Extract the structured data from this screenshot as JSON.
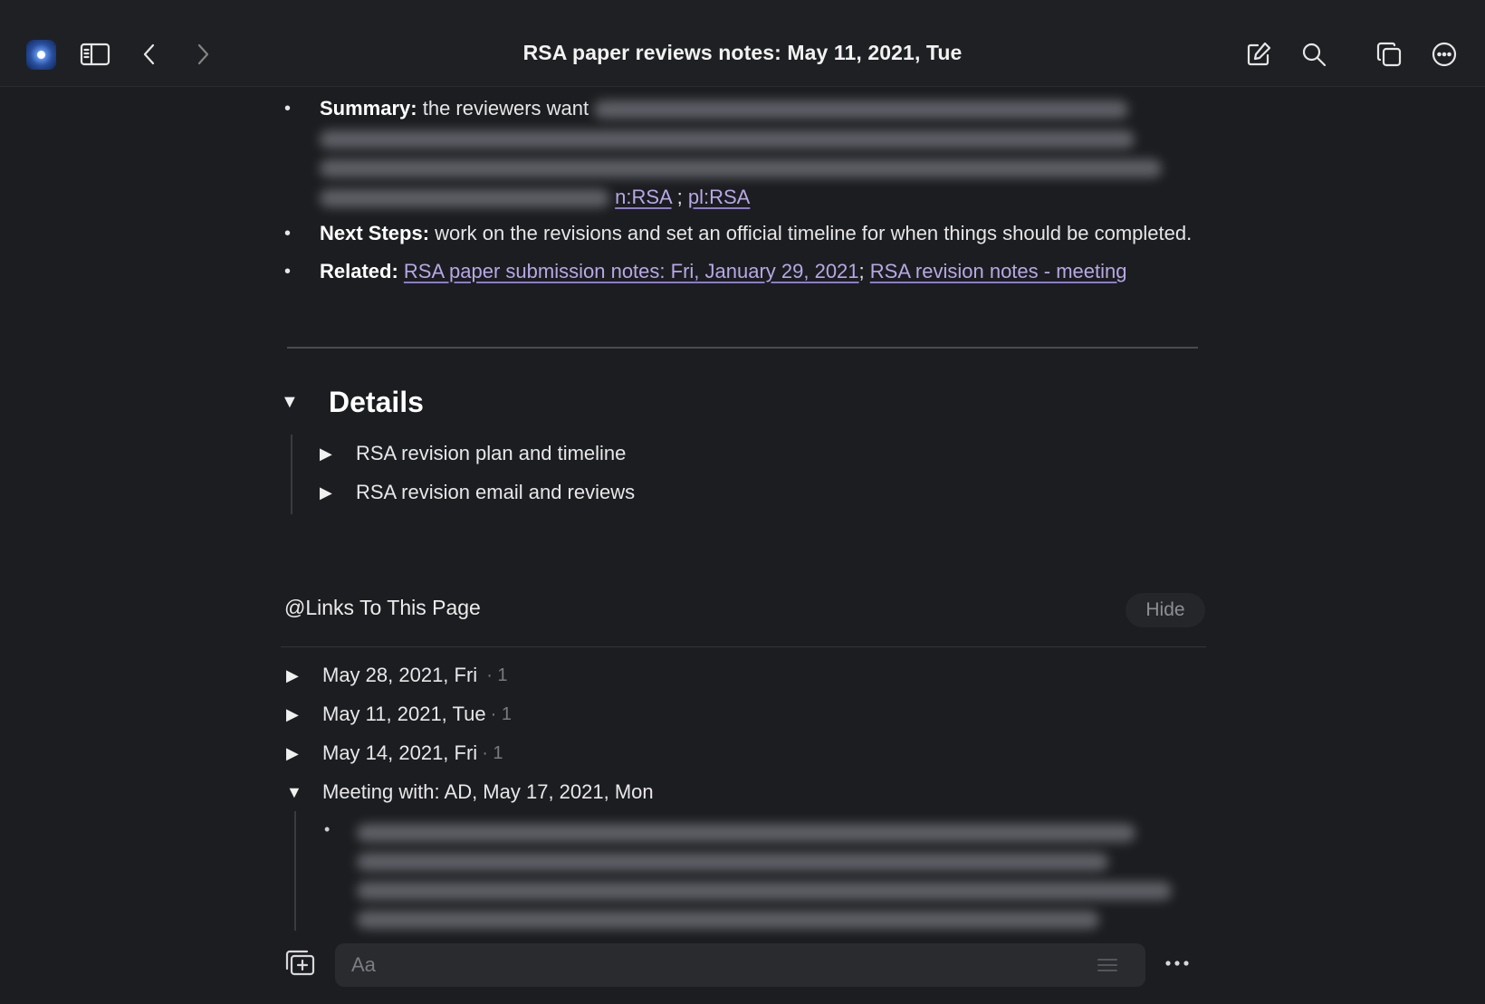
{
  "header": {
    "title": "RSA paper reviews notes: May 11, 2021, Tue"
  },
  "summary": {
    "label": "Summary:",
    "text_start": "the reviewers want",
    "link_1": "n:RSA",
    "separator": ";",
    "link_2": "pl:RSA"
  },
  "next_steps": {
    "label": "Next Steps:",
    "text": "work on the revisions and set an official timeline for when things should be completed."
  },
  "related": {
    "label": "Related:",
    "link_1": "RSA paper submission notes: Fri, January 29, 2021",
    "separator": ";",
    "link_2": "RSA revision notes - meeting"
  },
  "details": {
    "title": "Details",
    "items": [
      {
        "label": "RSA revision plan and timeline"
      },
      {
        "label": "RSA revision email and reviews"
      }
    ]
  },
  "links_to_page": {
    "title": "@Links To This Page",
    "hide_label": "Hide",
    "items": [
      {
        "label": "May 28, 2021, Fri",
        "count": "· 1"
      },
      {
        "label": "May 11, 2021, Tue",
        "count": "· 1"
      },
      {
        "label": "May 14, 2021, Fri",
        "count": "· 1"
      },
      {
        "label": "Meeting with: AD, May 17, 2021, Mon",
        "count": ""
      }
    ]
  },
  "composer": {
    "placeholder": "Aa"
  },
  "icons": {
    "app": "app-icon",
    "sidebar": "sidebar-toggle-icon",
    "back": "chevron-left-icon",
    "forward": "chevron-right-icon",
    "edit": "compose-icon",
    "search": "search-icon",
    "windows": "windows-icon",
    "more": "more-icon"
  },
  "colors": {
    "background": "#1c1d20",
    "link": "#b7a8e6"
  }
}
